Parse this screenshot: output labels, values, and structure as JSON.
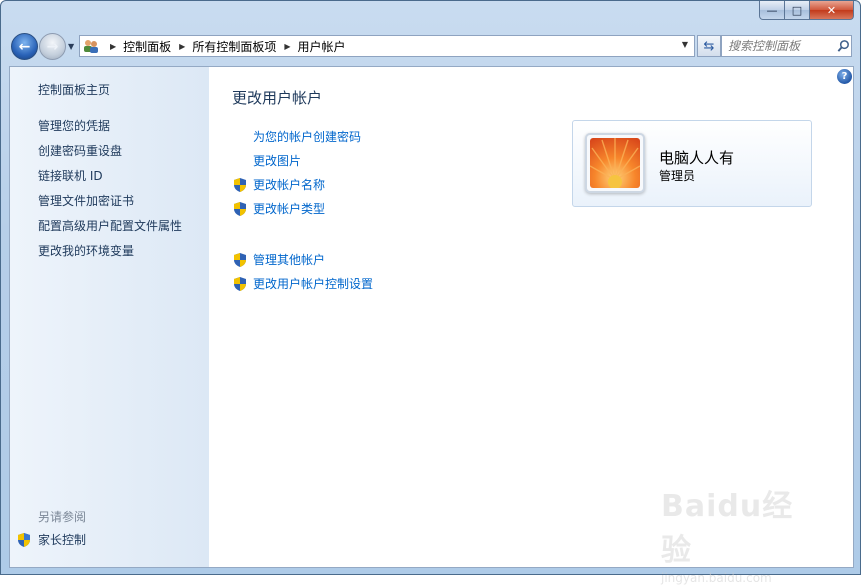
{
  "window": {
    "caption_min": "—",
    "caption_max": "□",
    "caption_close": "✕"
  },
  "nav": {
    "back_glyph": "←",
    "forward_glyph": "→",
    "breadcrumbs": [
      "控制面板",
      "所有控制面板项",
      "用户帐户"
    ],
    "search_placeholder": "搜索控制面板"
  },
  "sidebar": {
    "items": [
      "控制面板主页",
      "管理您的凭据",
      "创建密码重设盘",
      "链接联机 ID",
      "管理文件加密证书",
      "配置高级用户配置文件属性",
      "更改我的环境变量"
    ],
    "see_also": "另请参阅",
    "parental_controls": "家长控制"
  },
  "main": {
    "title": "更改用户帐户",
    "tasks": [
      {
        "label": "为您的帐户创建密码",
        "shield": false
      },
      {
        "label": "更改图片",
        "shield": false
      },
      {
        "label": "更改帐户名称",
        "shield": true
      },
      {
        "label": "更改帐户类型",
        "shield": true
      },
      {
        "label": "管理其他帐户",
        "shield": true
      },
      {
        "label": "更改用户帐户控制设置",
        "shield": true
      }
    ]
  },
  "user": {
    "name": "电脑人人有",
    "role": "管理员"
  },
  "help": "?",
  "watermark": {
    "logo": "Baidu经验",
    "url": "jingyan.baidu.com"
  },
  "colors": {
    "link": "#0066cc",
    "nav_text": "#1e395b",
    "sidebar_bg": "#dce8f5"
  }
}
